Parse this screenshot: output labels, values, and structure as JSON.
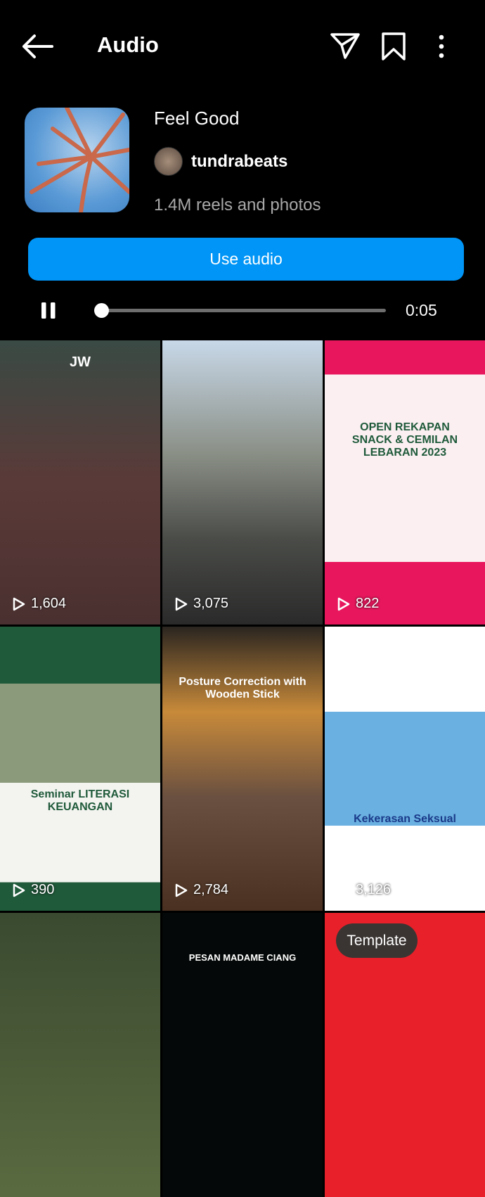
{
  "header": {
    "title": "Audio",
    "icons": [
      "back-arrow-icon",
      "send-icon",
      "bookmark-icon",
      "more-icon"
    ]
  },
  "audio": {
    "title": "Feel Good",
    "artist": "tundrabeats",
    "count": "1.4M reels and photos",
    "use_label": "Use audio",
    "time": "0:05",
    "progress_percent": 2
  },
  "grid": [
    {
      "views": "1,604",
      "caption": "JW",
      "bg": "linear-gradient(180deg,#3a4a44,#5a3a38 50%,#4a3030)"
    },
    {
      "views": "3,075",
      "caption": "",
      "bg": "linear-gradient(180deg,#c8d8e8,#8a8f86 40%,#4a4c48 70%,#2a2a2a)"
    },
    {
      "views": "822",
      "caption": "OPEN REKAPAN SNACK & CEMILAN LEBARAN 2023",
      "bg": "linear-gradient(180deg,#e8175d 0 12%,#fbeff2 12% 78%,#e8175d 78%)"
    },
    {
      "views": "390",
      "caption": "Seminar LITERASI KEUANGAN",
      "bg": "linear-gradient(180deg,#1f5a3a 0 20%,#8a9a7a 20% 55%,#f3f3f0 55% 90%,#1f5a3a 90%)"
    },
    {
      "views": "2,784",
      "caption": "Posture Correction with Wooden Stick",
      "bg": "linear-gradient(180deg,#2a2520,#c88a3a 30%,#6a5040 60%,#4a3020)"
    },
    {
      "views": "3,126",
      "caption": "Kekerasan Seksual",
      "bg": "linear-gradient(180deg,#fff 0 30%,#6ab0e0 30% 70%,#fff 70%)"
    },
    {
      "views": "",
      "caption": "",
      "bg": "linear-gradient(180deg,#3a4a30,#5a6a40)"
    },
    {
      "views": "",
      "caption": "PESAN MADAME CIANG",
      "bg": "#050808"
    },
    {
      "views": "",
      "caption": "",
      "bg": "#e8202a"
    }
  ],
  "template_label": "Template"
}
